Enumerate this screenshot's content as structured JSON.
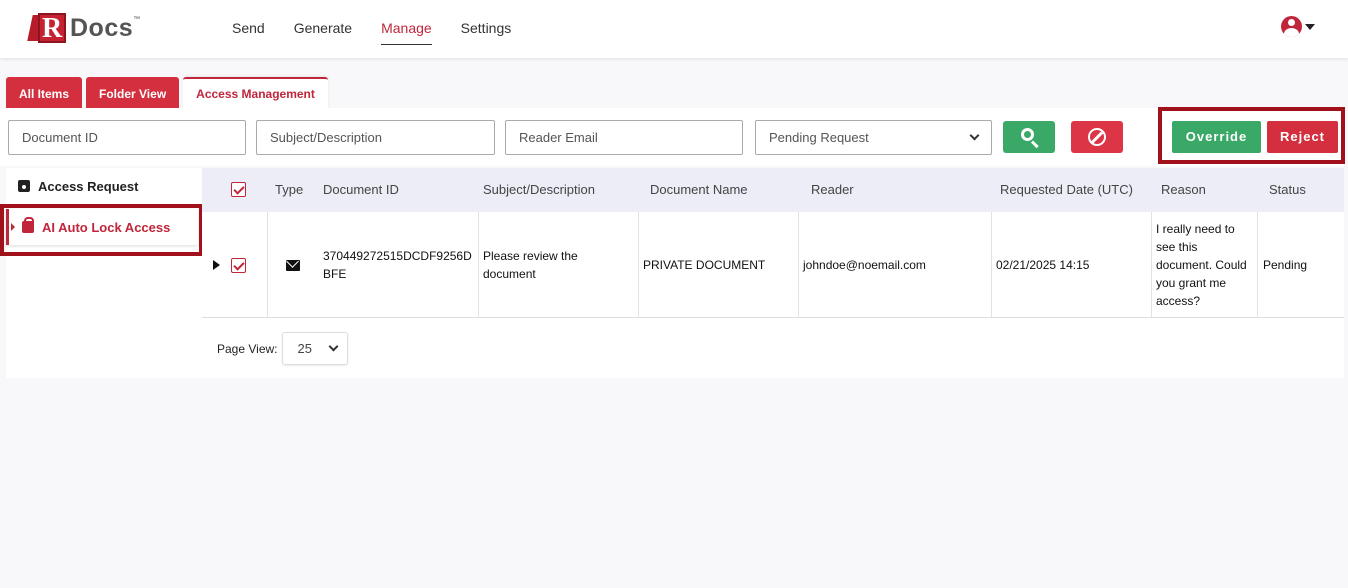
{
  "app": {
    "logo_text": "RDocs",
    "logo_tm": "™",
    "accent": "#c0263a"
  },
  "nav": {
    "items": [
      {
        "label": "Send"
      },
      {
        "label": "Generate"
      },
      {
        "label": "Manage",
        "active": true
      },
      {
        "label": "Settings"
      }
    ],
    "user_icon": "user-circle-icon"
  },
  "tabs": [
    {
      "label": "All Items"
    },
    {
      "label": "Folder View"
    },
    {
      "label": "Access Management",
      "active": true
    }
  ],
  "filters": {
    "document_id_placeholder": "Document ID",
    "subject_placeholder": "Subject/Description",
    "reader_email_placeholder": "Reader Email",
    "status_select_value": "Pending Request",
    "search_icon": "search-icon",
    "clear_icon": "ban-icon"
  },
  "actions": {
    "override_label": "Override",
    "reject_label": "Reject"
  },
  "sidebar": {
    "items": [
      {
        "label": "Access Request",
        "icon": "lock-box-icon"
      },
      {
        "label": "AI Auto Lock Access",
        "icon": "robot-lock-icon",
        "active": true
      }
    ]
  },
  "table": {
    "columns": [
      "Type",
      "Document ID",
      "Subject/Description",
      "Document Name",
      "Reader",
      "Requested Date (UTC)",
      "Reason",
      "Status"
    ],
    "rows": [
      {
        "type_icon": "envelope-icon",
        "document_id": "370449272515DCDF9256DBFE",
        "subject": "Please review the document",
        "document_name": "PRIVATE DOCUMENT",
        "reader": "johndoe@noemail.com",
        "requested_date": "02/21/2025 14:15",
        "reason": "I really need to see this document. Could you grant me access?",
        "status": "Pending",
        "checked": true
      }
    ]
  },
  "pagination": {
    "label": "Page View:",
    "page_size": "25"
  }
}
